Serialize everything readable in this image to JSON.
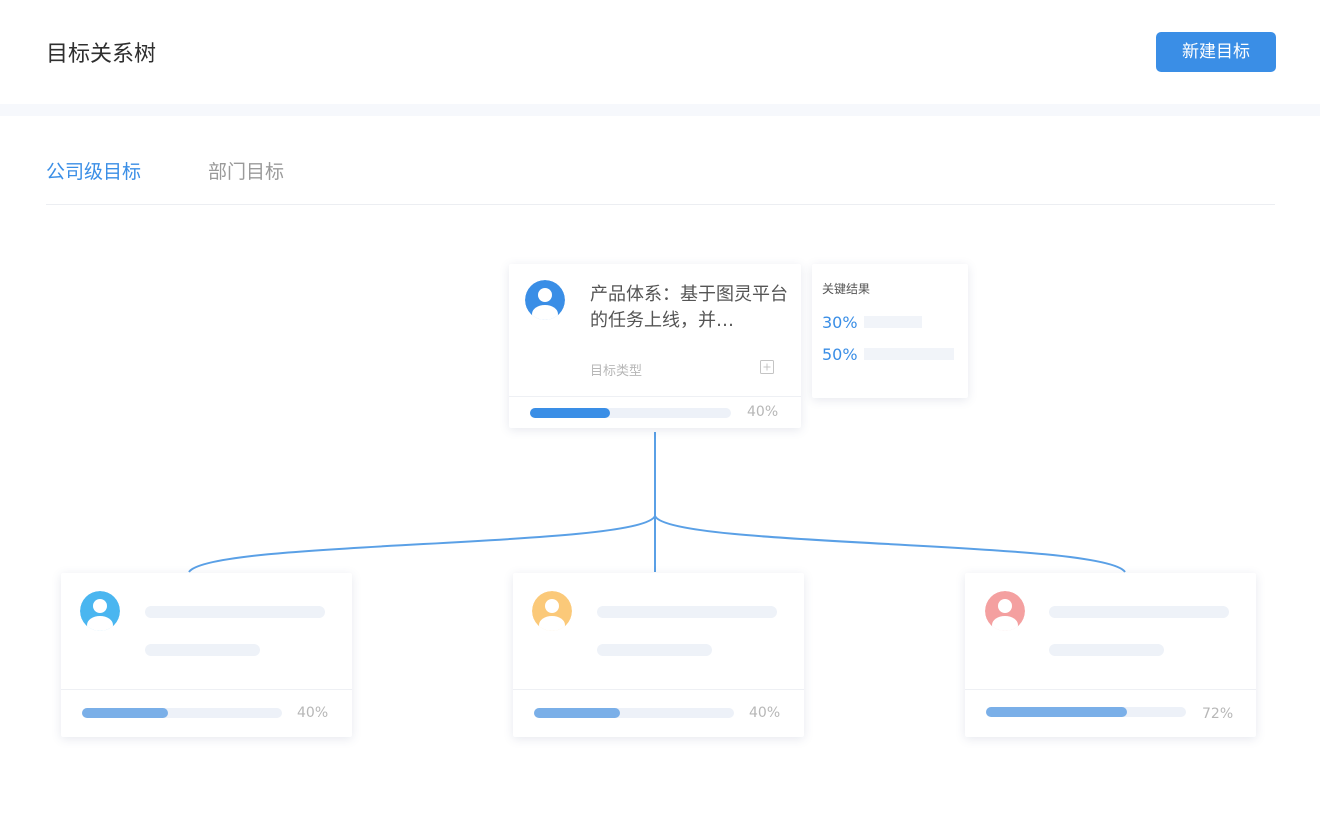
{
  "header": {
    "title": "目标关系树",
    "new_button": "新建目标"
  },
  "tabs": [
    {
      "label": "公司级目标",
      "active": true
    },
    {
      "label": "部门目标",
      "active": false
    }
  ],
  "root_card": {
    "title": "产品体系：基于图灵平台的任务上线，并…",
    "type_label": "目标类型",
    "progress": 0.4,
    "progress_label": "40%",
    "avatar_color": "#3a8ee6"
  },
  "key_results": {
    "title": "关键结果",
    "items": [
      {
        "value": "30%"
      },
      {
        "value": "50%"
      }
    ]
  },
  "child_cards": [
    {
      "avatar_color": "#4ab6f0",
      "progress": 0.43,
      "progress_label": "40%"
    },
    {
      "avatar_color": "#fbc979",
      "progress": 0.43,
      "progress_label": "40%"
    },
    {
      "avatar_color": "#f4a0a0",
      "progress": 0.705,
      "progress_label": "72%"
    }
  ],
  "colors": {
    "accent": "#3a8ee6",
    "line": "#5aa0e6",
    "child_fill": "#7aafe8"
  },
  "icons": {
    "avatar": "user-avatar-icon",
    "expand": "plus-square-icon"
  }
}
